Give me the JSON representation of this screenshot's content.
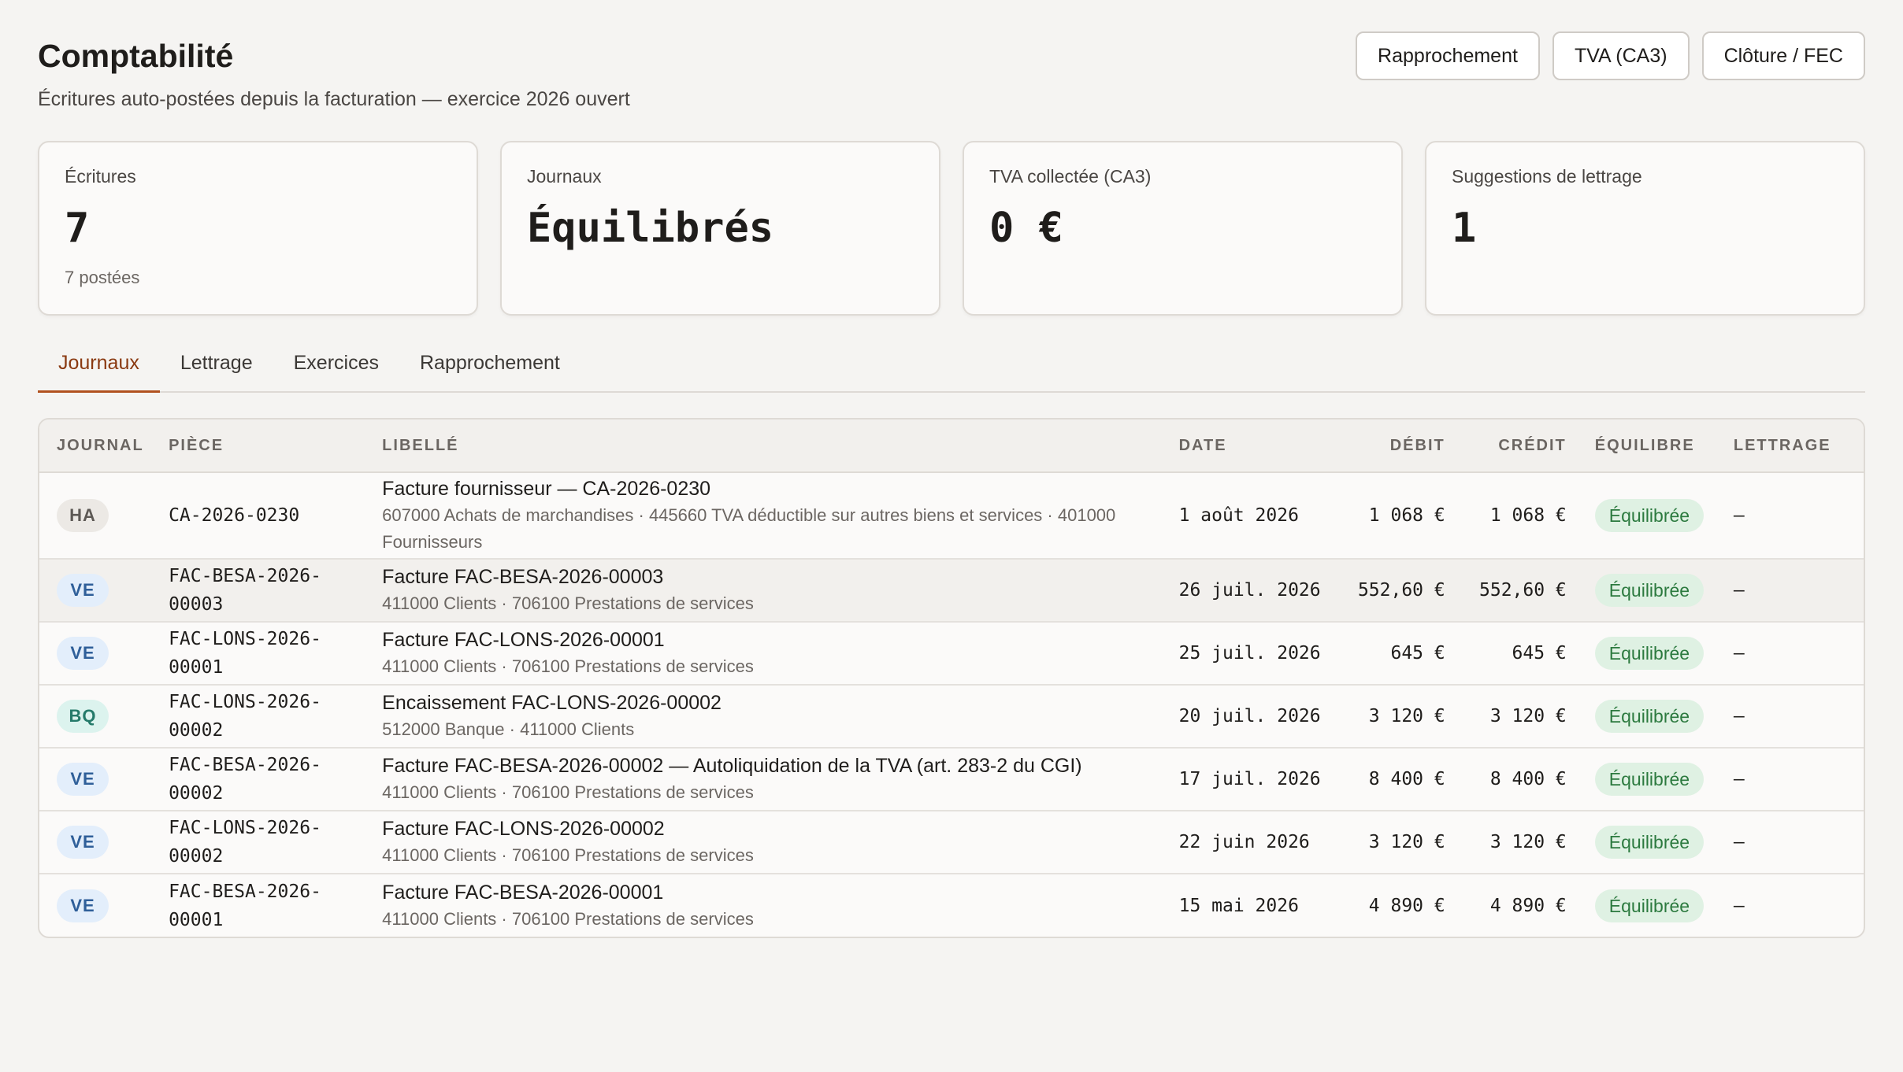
{
  "header": {
    "title": "Comptabilité",
    "subtitle": "Écritures auto-postées depuis la facturation — exercice 2026 ouvert",
    "actions": [
      "Rapprochement",
      "TVA (CA3)",
      "Clôture / FEC"
    ]
  },
  "cards": [
    {
      "label": "Écritures",
      "value": "7",
      "sub": "7 postées"
    },
    {
      "label": "Journaux",
      "value": "Équilibrés",
      "sub": ""
    },
    {
      "label": "TVA collectée (CA3)",
      "value": "0 €",
      "sub": ""
    },
    {
      "label": "Suggestions de lettrage",
      "value": "1",
      "sub": ""
    }
  ],
  "tabs": [
    "Journaux",
    "Lettrage",
    "Exercices",
    "Rapprochement"
  ],
  "active_tab": "Journaux",
  "colors": {
    "accent": "#b1511f",
    "badge_HA_bg": "#ece9e5",
    "badge_HA_fg": "#5d5955",
    "badge_VE_bg": "#e3eefb",
    "badge_VE_fg": "#2f5f99",
    "badge_BQ_bg": "#dcf3ee",
    "badge_BQ_fg": "#257a6a",
    "status_bg": "#dff1e3",
    "status_fg": "#2c7a3f"
  },
  "table": {
    "columns": [
      "JOURNAL",
      "PIÈCE",
      "LIBELLÉ",
      "DATE",
      "DÉBIT",
      "CRÉDIT",
      "ÉQUILIBRE",
      "LETTRAGE"
    ],
    "rows": [
      {
        "journal": "HA",
        "piece": "CA-2026-0230",
        "title": "Facture fournisseur — CA-2026-0230",
        "accounts": "607000 Achats de marchandises · 445660 TVA déductible sur autres biens et services · 401000 Fournisseurs",
        "date": "1 août 2026",
        "debit": "1 068 €",
        "credit": "1 068 €",
        "status": "Équilibrée",
        "lettrage": "—"
      },
      {
        "journal": "VE",
        "piece": "FAC-BESA-2026-00003",
        "title": "Facture FAC-BESA-2026-00003",
        "accounts": "411000 Clients · 706100 Prestations de services",
        "date": "26 juil. 2026",
        "debit": "552,60 €",
        "credit": "552,60 €",
        "status": "Équilibrée",
        "lettrage": "—"
      },
      {
        "journal": "VE",
        "piece": "FAC-LONS-2026-00001",
        "title": "Facture FAC-LONS-2026-00001",
        "accounts": "411000 Clients · 706100 Prestations de services",
        "date": "25 juil. 2026",
        "debit": "645 €",
        "credit": "645 €",
        "status": "Équilibrée",
        "lettrage": "—"
      },
      {
        "journal": "BQ",
        "piece": "FAC-LONS-2026-00002",
        "title": "Encaissement FAC-LONS-2026-00002",
        "accounts": "512000 Banque · 411000 Clients",
        "date": "20 juil. 2026",
        "debit": "3 120 €",
        "credit": "3 120 €",
        "status": "Équilibrée",
        "lettrage": "—"
      },
      {
        "journal": "VE",
        "piece": "FAC-BESA-2026-00002",
        "title": "Facture FAC-BESA-2026-00002 — Autoliquidation de la TVA (art. 283-2 du CGI)",
        "accounts": "411000 Clients · 706100 Prestations de services",
        "date": "17 juil. 2026",
        "debit": "8 400 €",
        "credit": "8 400 €",
        "status": "Équilibrée",
        "lettrage": "—"
      },
      {
        "journal": "VE",
        "piece": "FAC-LONS-2026-00002",
        "title": "Facture FAC-LONS-2026-00002",
        "accounts": "411000 Clients · 706100 Prestations de services",
        "date": "22 juin 2026",
        "debit": "3 120 €",
        "credit": "3 120 €",
        "status": "Équilibrée",
        "lettrage": "—"
      },
      {
        "journal": "VE",
        "piece": "FAC-BESA-2026-00001",
        "title": "Facture FAC-BESA-2026-00001",
        "accounts": "411000 Clients · 706100 Prestations de services",
        "date": "15 mai 2026",
        "debit": "4 890 €",
        "credit": "4 890 €",
        "status": "Équilibrée",
        "lettrage": "—"
      }
    ]
  }
}
